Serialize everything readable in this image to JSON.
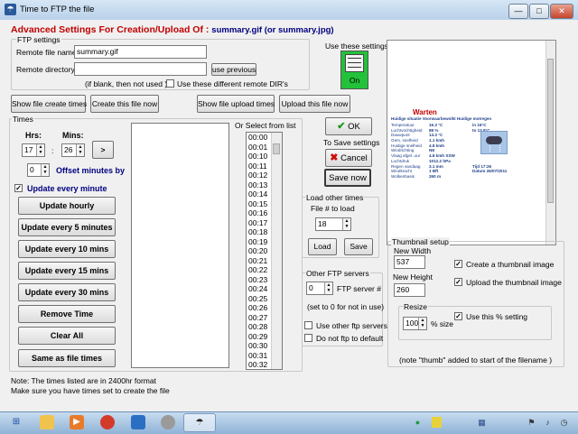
{
  "window": {
    "title": "Time to FTP the file",
    "minimize": "—",
    "maximize": "□",
    "close": "✕"
  },
  "heading": {
    "prefix": "Advanced Settings For Creation/Upload Of :",
    "files": "summary.gif  (or summary.jpg)"
  },
  "ftp_settings": {
    "label": "FTP settings",
    "remote_file_label": "Remote file name",
    "remote_file_value": "summary.gif",
    "remote_dir_label": "Remote directory",
    "remote_dir_value": "",
    "use_previous": "use previous",
    "blank_note": "(if blank, then not used )",
    "different_dirs_label": "Use these different remote DIR's"
  },
  "use_settings": {
    "label": "Use these settings",
    "state": "On"
  },
  "actions": {
    "show_create": "Show file create times",
    "create_now": "Create this file now",
    "show_upload": "Show file upload times",
    "upload_now": "Upload this file now"
  },
  "times": {
    "label": "Times",
    "hrs_label": "Hrs:",
    "mins_label": "Mins:",
    "hrs": "17",
    "mins": "26",
    "colon": ":",
    "arrow": ">",
    "offset": "0",
    "offset_label": "Offset minutes by",
    "update_every_minute": "Update every minute",
    "buttons": [
      "Update hourly",
      "Update every 5 minutes",
      "Update every 10 mins",
      "Update every 15 mins",
      "Update every 30 mins",
      "Remove Time",
      "Clear All",
      "Same as file times"
    ]
  },
  "select_list": {
    "label": "Or Select from list",
    "items": [
      "00:00",
      "00:01",
      "00:10",
      "00:11",
      "00:12",
      "00:13",
      "00:14",
      "00:15",
      "00:16",
      "00:17",
      "00:18",
      "00:19",
      "00:20",
      "00:21",
      "00:22",
      "00:23",
      "00:24",
      "00:25",
      "00:26",
      "00:27",
      "00:28",
      "00:29",
      "00:30",
      "00:31",
      "00:32"
    ]
  },
  "ok": {
    "ok": "OK",
    "save_label": "To Save settings",
    "cancel": "Cancel",
    "save_now": "Save now"
  },
  "load_times": {
    "label": "Load other times",
    "file_label": "File # to load",
    "file_value": "18",
    "load": "Load",
    "save": "Save"
  },
  "ftp_servers": {
    "label": "Other FTP servers",
    "server_value": "0",
    "server_label": "FTP server #",
    "note": "(set to 0 for not in use)",
    "use_other": "Use other ftp servers",
    "do_not_ftp": "Do not ftp to default"
  },
  "preview": {
    "title": "Warten",
    "subtitle": "Huidige situatie  Voorwaarbewolkt Huidige motregen",
    "rows": [
      [
        "Temperatuur",
        "16.3 °C",
        "in 16°C"
      ],
      [
        "Luchtvochtigheid",
        "88 %",
        "to 13.8°C"
      ],
      [
        "Dauwpunt",
        "14.3 °C",
        ""
      ],
      [
        "Gem. snelheid",
        "1.1 kmh",
        ""
      ],
      [
        "Huidige snelheid",
        "4.8 kmh",
        ""
      ],
      [
        "Windrichting",
        "NE",
        ""
      ],
      [
        "Vlaag afgel. uur",
        "4.8 kmh SSW",
        ""
      ],
      [
        "Luchtdruk",
        "1012.2 hPa",
        ""
      ],
      [
        "Regen vandaag",
        "3.1 mm",
        "Tijd 17:26"
      ],
      [
        "Windkracht",
        "1 Bft",
        "Datum 26/07/2011"
      ],
      [
        "Wolkenbasis",
        "260 m",
        ""
      ]
    ]
  },
  "thumbnail": {
    "label": "Thumbnail setup",
    "width_label": "New Width",
    "width": "537",
    "height_label": "New Height",
    "height": "260",
    "create_label": "Create a thumbnail image",
    "upload_label": "Upload the thumbnail image",
    "resize_label": "Resize",
    "resize_value": "100",
    "size_label": "% size",
    "use_percent": "Use this % setting",
    "note": "(note \"thumb\" added to start of the filename )"
  },
  "notes": [
    "Note: The times listed are in 2400hr format",
    "Make sure you have times set to create the file"
  ],
  "taskbar": {
    "icons": [
      "windows-icon",
      "explorer-icon",
      "player-icon",
      "app-icon",
      "disk-icon",
      "network-icon",
      "weather-icon"
    ],
    "tray": [
      "green-dot-icon",
      "badge-icon",
      "network-tray-icon",
      "flag-icon",
      "volume-icon",
      "clock-icon"
    ]
  },
  "colors": {
    "heading_red": "#c00000",
    "heading_blue": "#000080",
    "on_green": "#23c23a",
    "title_blue": "#b9d1ea"
  }
}
